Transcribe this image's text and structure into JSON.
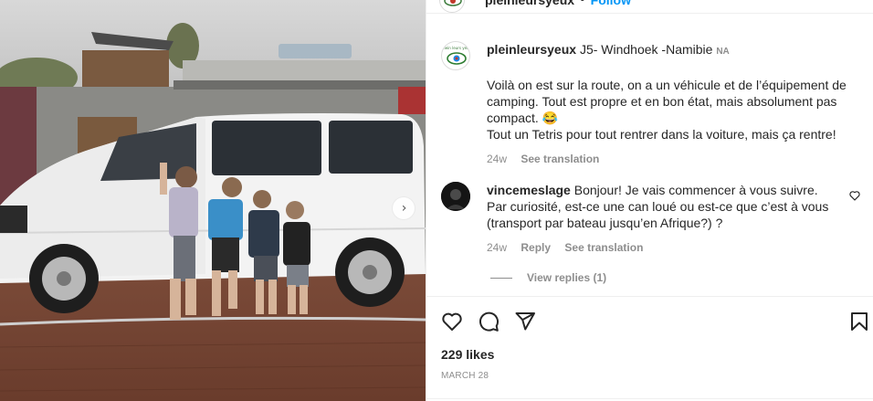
{
  "post": {
    "username": "pleinleursyeux",
    "location": "J5- Windhoek -Namibie",
    "tag": "NA",
    "follow_label": "Follow",
    "separator": "•",
    "caption_line1": "Voilà on est sur la route, on a un véhicule et de l’équipement de camping. Tout est propre et en bon état, mais absolument pas compact. 😂",
    "caption_line2": "Tout un Tetris pour tout rentrer dans la voiture, mais ça rentre!",
    "caption_time": "24w",
    "see_translation": "See translation"
  },
  "comment": {
    "username": "vincemeslage",
    "text": "Bonjour! Je vais commencer à vous suivre. Par curiosité, est-ce une can loué ou est-ce que c’est à vous (transport par bateau jusqu’en Afrique?) ?",
    "time": "24w",
    "reply_label": "Reply",
    "see_translation": "See translation",
    "view_replies": "View replies (1)"
  },
  "footer": {
    "likes": "229 likes",
    "date": "MARCH 28"
  },
  "icons": {
    "like": "heart-icon",
    "comment": "comment-icon",
    "share": "paper-plane-icon",
    "save": "bookmark-icon",
    "carousel_next": "chevron-right-icon"
  },
  "colors": {
    "link_blue": "#0095f6",
    "secondary_text": "#8e8e8e",
    "primary_text": "#262626"
  }
}
